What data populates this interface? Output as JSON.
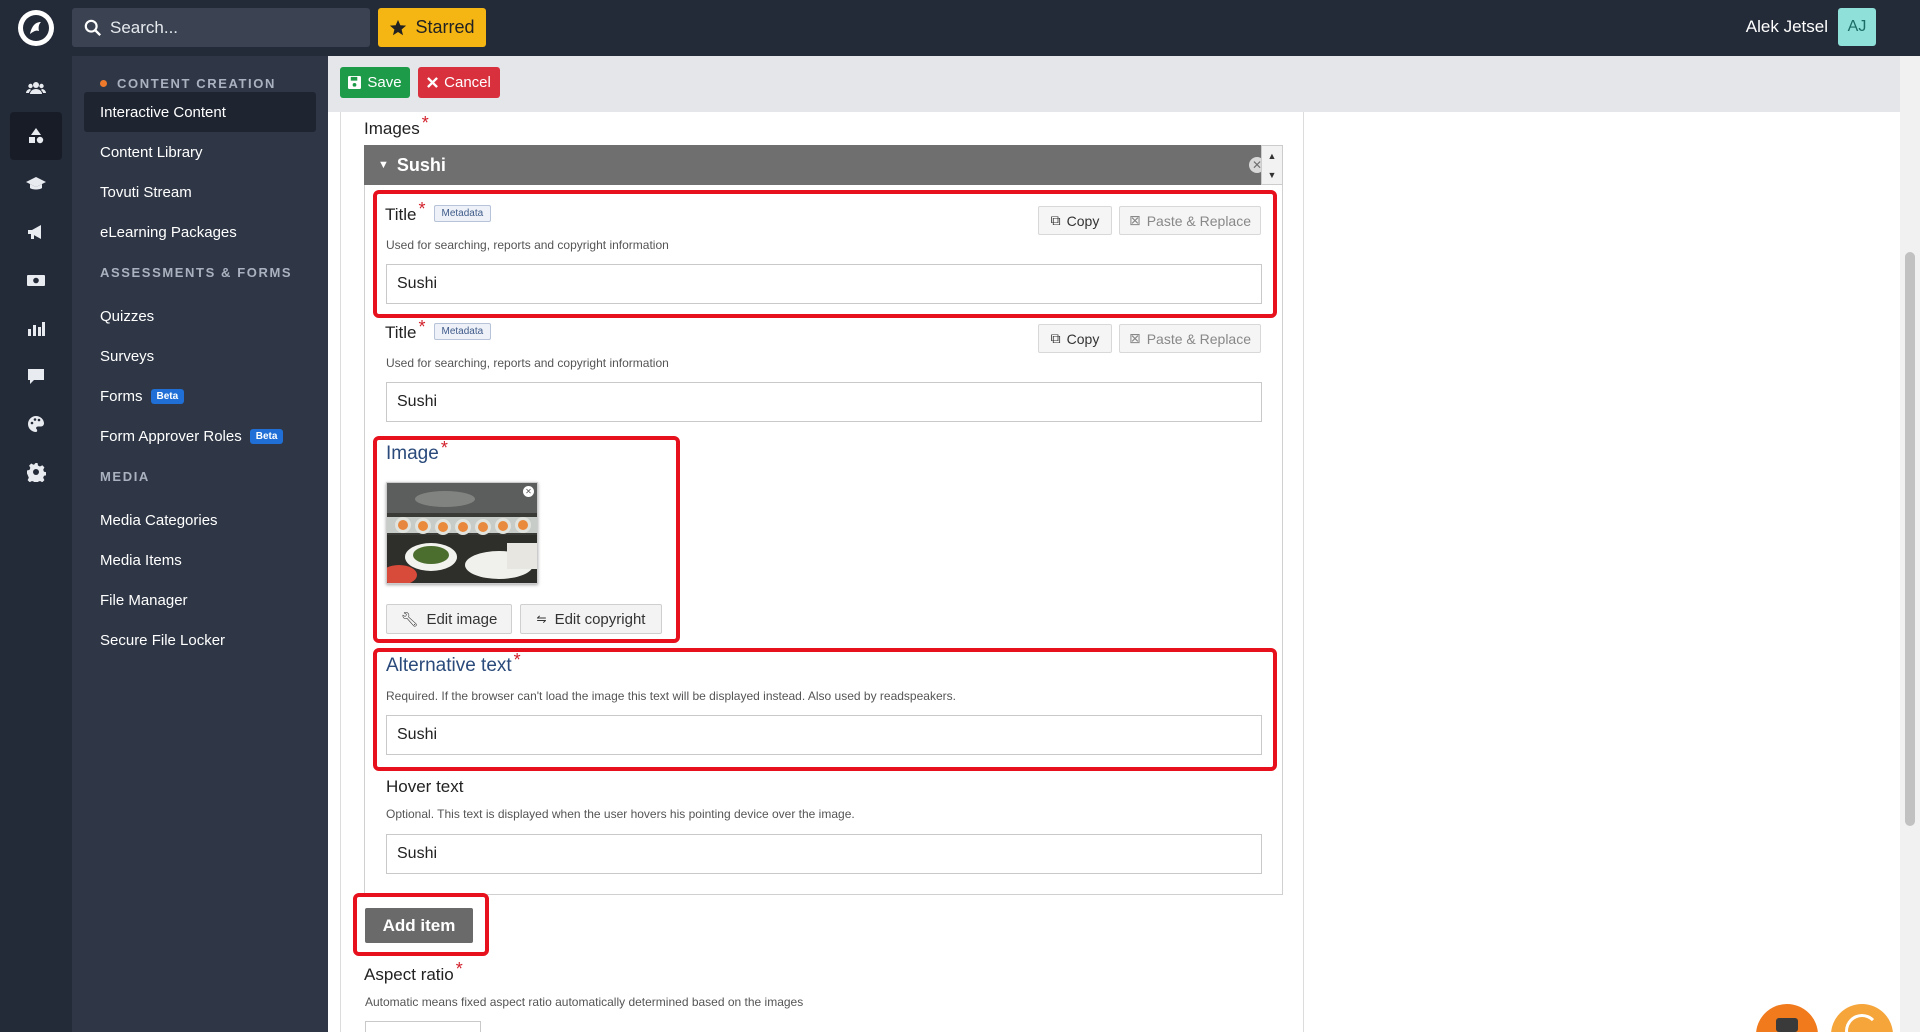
{
  "topbar": {
    "search_placeholder": "Search...",
    "starred_label": "Starred",
    "user_name": "Alek Jetsel",
    "user_initials": "AJ"
  },
  "rail": {
    "icons": [
      "users-icon",
      "shapes-icon",
      "graduation-cap-icon",
      "megaphone-icon",
      "money-icon",
      "chart-icon",
      "chat-icon",
      "palette-icon",
      "gear-icon"
    ],
    "active_index": 1
  },
  "sidebar": {
    "section_content": "CONTENT CREATION",
    "content_items": [
      "Interactive Content",
      "Content Library",
      "Tovuti Stream",
      "eLearning Packages"
    ],
    "section_assessments": "ASSESSMENTS & FORMS",
    "assessment_items": [
      "Quizzes",
      "Surveys",
      "Forms",
      "Form Approver Roles"
    ],
    "beta_label": "Beta",
    "section_media": "MEDIA",
    "media_items": [
      "Media Categories",
      "Media Items",
      "File Manager",
      "Secure File Locker"
    ]
  },
  "toolbar": {
    "save_label": "Save",
    "cancel_label": "Cancel"
  },
  "form": {
    "images_label": "Images",
    "group_title": "Sushi",
    "title_label": "Title",
    "metadata_tag": "Metadata",
    "title_desc": "Used for searching, reports and copyright information",
    "copy_label": "Copy",
    "paste_label": "Paste & Replace",
    "title_value_1": "Sushi",
    "title_value_2": "Sushi",
    "image_label": "Image",
    "edit_image_label": "Edit image",
    "edit_copyright_label": "Edit copyright",
    "alt_label": "Alternative text",
    "alt_desc": "Required. If the browser can't load the image this text will be displayed instead. Also used by readspeakers.",
    "alt_value": "Sushi",
    "hover_label": "Hover text",
    "hover_desc": "Optional. This text is displayed when the user hovers his pointing device over the image.",
    "hover_value": "Sushi",
    "add_item_label": "Add item",
    "aspect_label": "Aspect ratio",
    "aspect_desc": "Automatic means fixed aspect ratio automatically determined based on the images"
  },
  "colors": {
    "topbar": "#232a38",
    "sidebar": "#2f3746",
    "save": "#1e9b49",
    "cancel": "#d9303e",
    "starred": "#f5b614",
    "highlight": "#e6111c"
  }
}
